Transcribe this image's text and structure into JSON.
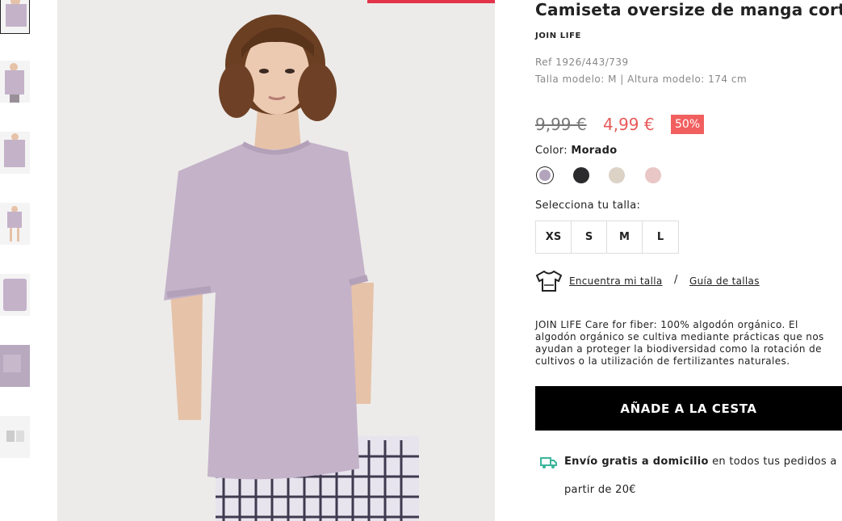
{
  "product": {
    "title": "Camiseta oversize de manga corta",
    "collection": "JOIN LIFE",
    "ref": "Ref 1926/443/739",
    "model_info": "Talla modelo: M | Altura modelo: 174 cm"
  },
  "price": {
    "old": "9,99 €",
    "new": "4,99 €",
    "discount": "50%"
  },
  "color": {
    "label": "Color:",
    "selected_name": "Morado",
    "swatches": [
      "#b3a4bd",
      "#2b2b2d",
      "#dcd2c6",
      "#e9c7c6"
    ]
  },
  "sizes": {
    "label": "Selecciona tu talla:",
    "options": [
      "XS",
      "S",
      "M",
      "L"
    ]
  },
  "size_help": {
    "find_label": "Encuentra mi talla",
    "separator": "/",
    "guide_label": "Guía de tallas"
  },
  "description": "JOIN LIFE Care for fiber: 100% algodón orgánico. El algodón orgánico se cultiva mediante prácticas que nos ayudan a proteger la biodiversidad como la rotación de cultivos o la utilización de fertilizantes naturales.",
  "cta": {
    "add_to_cart": "AÑADE A LA CESTA"
  },
  "shipping": {
    "bold": "Envío gratis a domicilio",
    "rest_line1": " en todos tus pedidos a",
    "line2": "partir de 20€"
  },
  "colors": {
    "accent": "#e2334a",
    "sale": "#f25f5f",
    "shipping_icon": "#3bb59a"
  }
}
